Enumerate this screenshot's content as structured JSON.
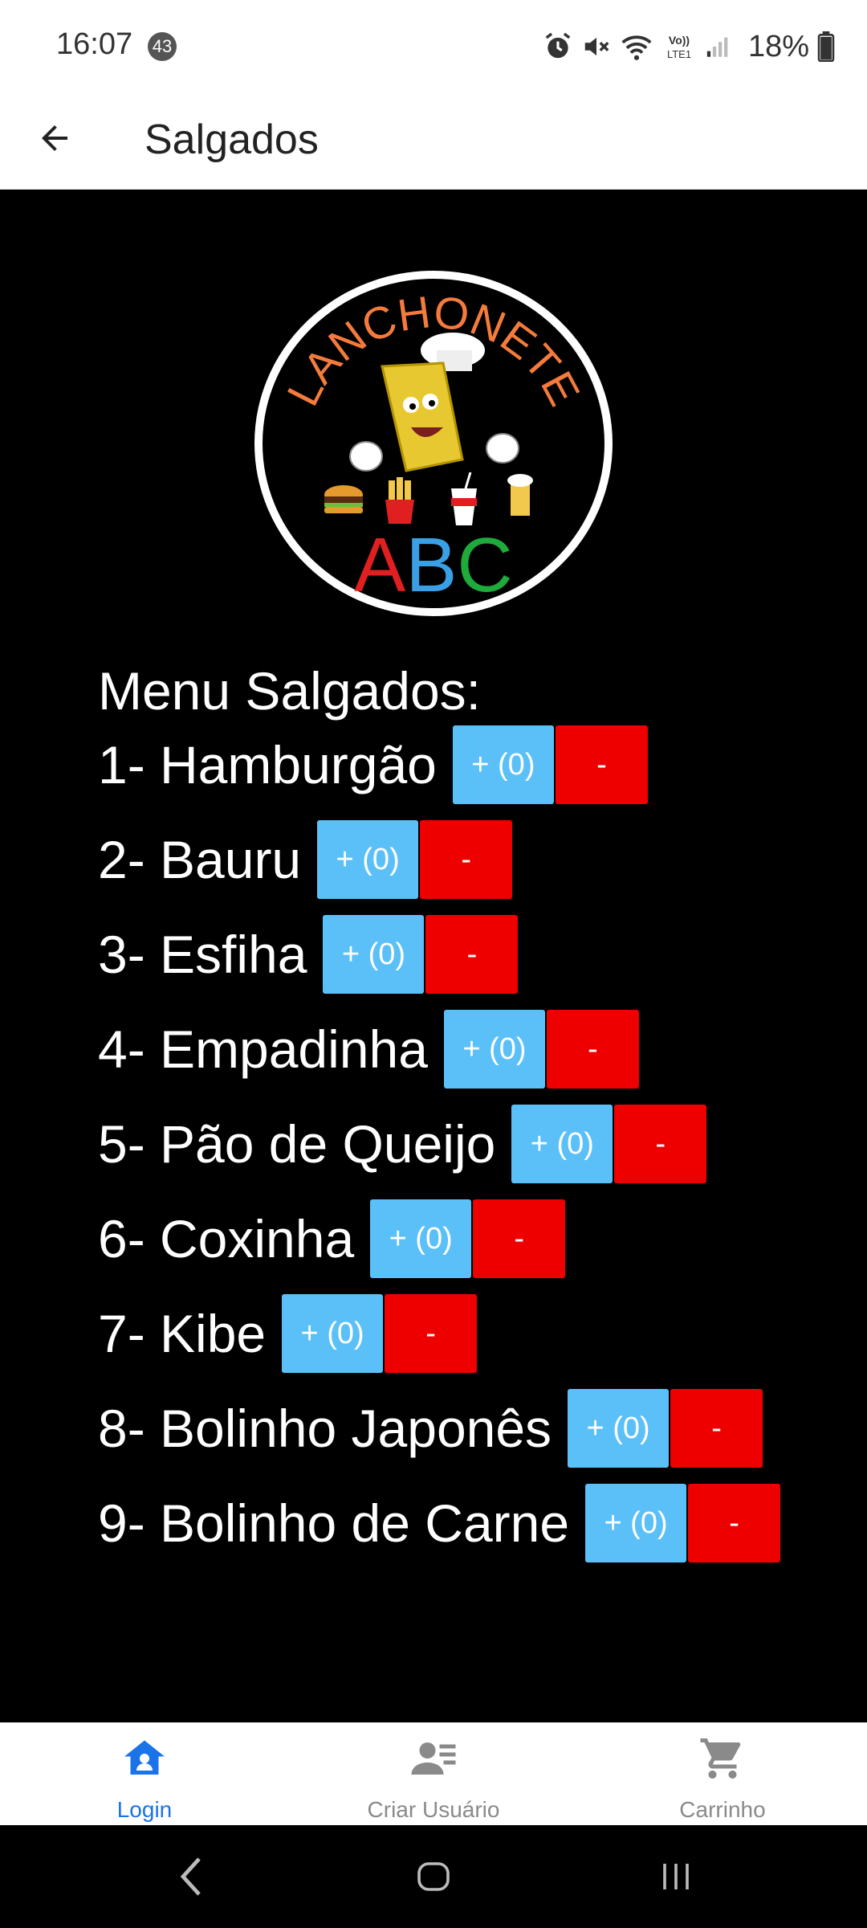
{
  "status_bar": {
    "time": "16:07",
    "notification_count": "43",
    "battery": "18%",
    "icons": [
      "alarm-icon",
      "mute-icon",
      "wifi-icon",
      "volte-icon",
      "signal-icon",
      "battery-icon"
    ],
    "volte_text": "Vo)) LTE1"
  },
  "app_bar": {
    "title": "Salgados",
    "back_icon": "arrow-left-icon"
  },
  "logo": {
    "top_text": "LANCHONETE",
    "bottom_text": "ABC"
  },
  "menu": {
    "heading": "Menu Salgados:",
    "add_label": "+ (0)",
    "remove_label": "-",
    "items": [
      {
        "label": "1- Hamburgão"
      },
      {
        "label": "2- Bauru"
      },
      {
        "label": "3- Esfiha"
      },
      {
        "label": "4- Empadinha"
      },
      {
        "label": "5- Pão de Queijo"
      },
      {
        "label": "6- Coxinha"
      },
      {
        "label": "7- Kibe"
      },
      {
        "label": "8- Bolinho Japonês"
      },
      {
        "label": "9- Bolinho de Carne"
      }
    ]
  },
  "bottom_nav": {
    "items": [
      {
        "label": "Login",
        "icon": "home-icon",
        "active": true
      },
      {
        "label": "Criar Usuário",
        "icon": "user-list-icon",
        "active": false
      },
      {
        "label": "Carrinho",
        "icon": "cart-icon",
        "active": false
      }
    ]
  },
  "colors": {
    "active_nav": "#1a73e8",
    "inactive_nav": "#8a8a8a",
    "add_button": "#5bc0f8",
    "remove_button": "#ee0000",
    "background": "#000000"
  }
}
